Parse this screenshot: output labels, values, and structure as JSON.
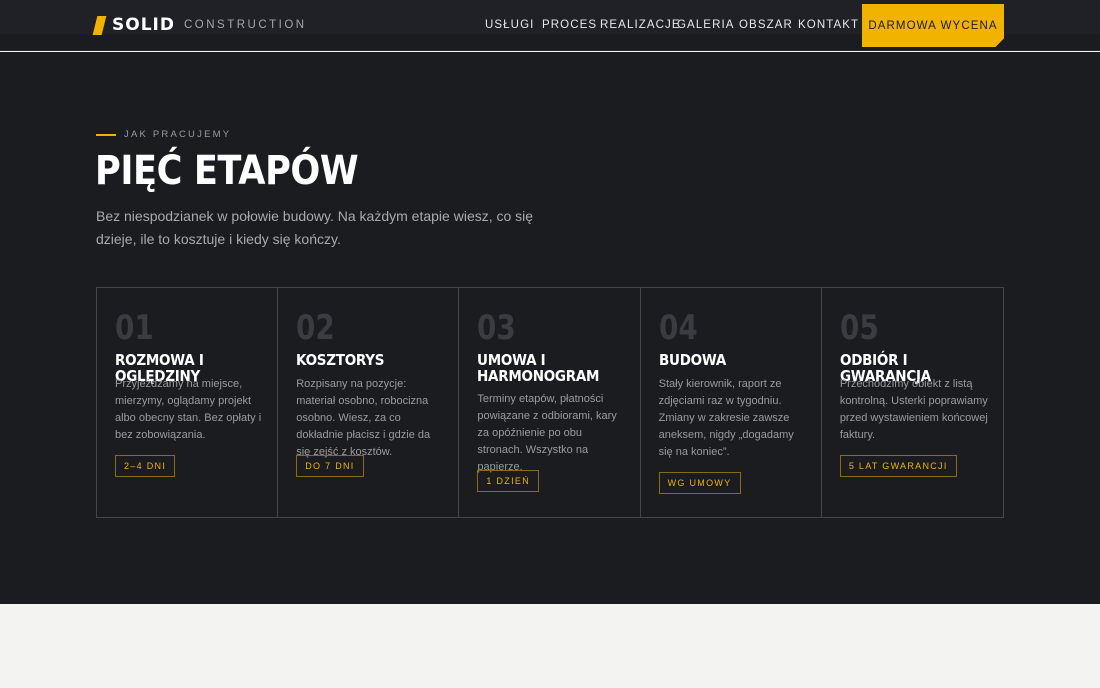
{
  "brand": {
    "name": "SOLID",
    "sub": "CONSTRUCTION",
    "accent": "#f2b200"
  },
  "nav": {
    "items": [
      {
        "label": "USŁUGI"
      },
      {
        "label": "PROCES"
      },
      {
        "label": "REALIZACJE"
      },
      {
        "label": "GALERIA"
      },
      {
        "label": "OBSZAR"
      },
      {
        "label": "KONTAKT"
      }
    ],
    "cta": "DARMOWA WYCENA"
  },
  "section": {
    "eyebrow": "JAK PRACUJEMY",
    "heading": "PIĘĆ ETAPÓW",
    "lead": "Bez niespodzianek w połowie budowy. Na każdym etapie wiesz, co się dzieje, ile to kosztuje i kiedy się kończy.",
    "steps": [
      {
        "num": "01",
        "title": "ROZMOWA I OGLĘDZINY",
        "desc": "Przyjeżdżamy na miejsce, mierzymy, oglądamy projekt albo obecny stan. Bez opłaty i bez zobowiązania.",
        "badge": "2–4 DNI"
      },
      {
        "num": "02",
        "title": "KOSZTORYS",
        "desc": "Rozpisany na pozycje: materiał osobno, robocizna osobno. Wiesz, za co dokładnie płacisz i gdzie da się zejść z kosztów.",
        "badge": "DO 7 DNI"
      },
      {
        "num": "03",
        "title": "UMOWA I HARMONOGRAM",
        "desc": "Terminy etapów, płatności powiązane z odbiorami, kary za opóźnienie po obu stronach. Wszystko na papierze.",
        "badge": "1 DZIEŃ"
      },
      {
        "num": "04",
        "title": "BUDOWA",
        "desc": "Stały kierownik, raport ze zdjęciami raz w tygodniu. Zmiany w zakresie zawsze aneksem, nigdy „dogadamy się na koniec”.",
        "badge": "WG UMOWY"
      },
      {
        "num": "05",
        "title": "ODBIÓR I GWARANCJA",
        "desc": "Przechodzimy obiekt z listą kontrolną. Usterki poprawiamy przed wystawieniem końcowej faktury.",
        "badge": "5 LAT GWARANCJI"
      }
    ]
  }
}
